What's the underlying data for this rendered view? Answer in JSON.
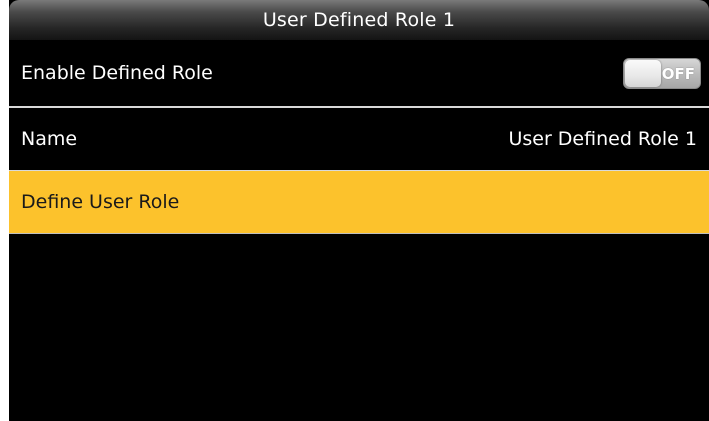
{
  "header": {
    "title": "User Defined Role 1"
  },
  "settings": {
    "enable_defined_role": {
      "label": "Enable Defined Role",
      "toggle_state": "OFF"
    },
    "name": {
      "label": "Name",
      "value": "User Defined Role 1"
    },
    "define_user_role": {
      "label": "Define User Role"
    }
  },
  "colors": {
    "background": "#000000",
    "highlight": "#fcc22c",
    "text": "#ffffff"
  },
  "icons": {
    "toggle": "off-toggle-switch"
  }
}
